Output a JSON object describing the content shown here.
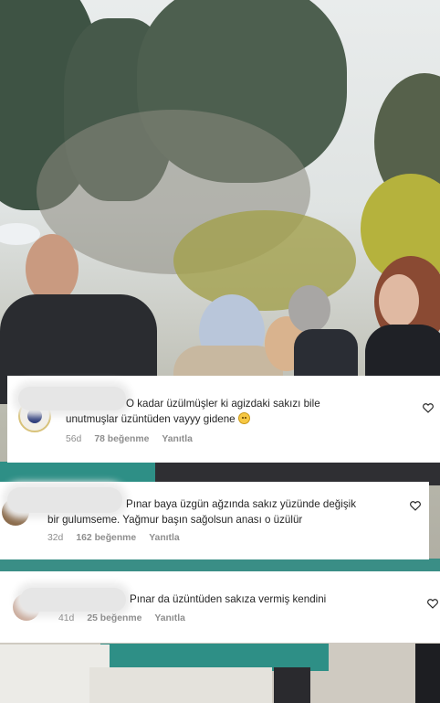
{
  "comments": [
    {
      "text_line1": "O kadar üzülmüşler ki agizdaki sakızı bile",
      "text_line2": "unutmuşlar üzüntüden vayyy gidene",
      "emoji": "sad-face-emoji",
      "age": "56d",
      "likes": "78 beğenme",
      "reply": "Yanıtla"
    },
    {
      "text_line1": "Pınar baya üzgün ağzında sakız yüzünde değişik",
      "text_line2": "bir gulumseme. Yağmur başın sağolsun anası o üzülür",
      "age": "32d",
      "likes": "162 beğenme",
      "reply": "Yanıtla"
    },
    {
      "text_line1": "Pınar da üzüntüden sakıza vermiş kendini",
      "age": "41d",
      "likes": "25 beğenme",
      "reply": "Yanıtla"
    }
  ],
  "icons": {
    "like": "heart-outline-icon",
    "avatar": "blurred-avatar"
  },
  "colors": {
    "text": "#262626",
    "meta": "#8e8e8e",
    "card": "#ffffff",
    "coffin": "#2e8f86"
  }
}
